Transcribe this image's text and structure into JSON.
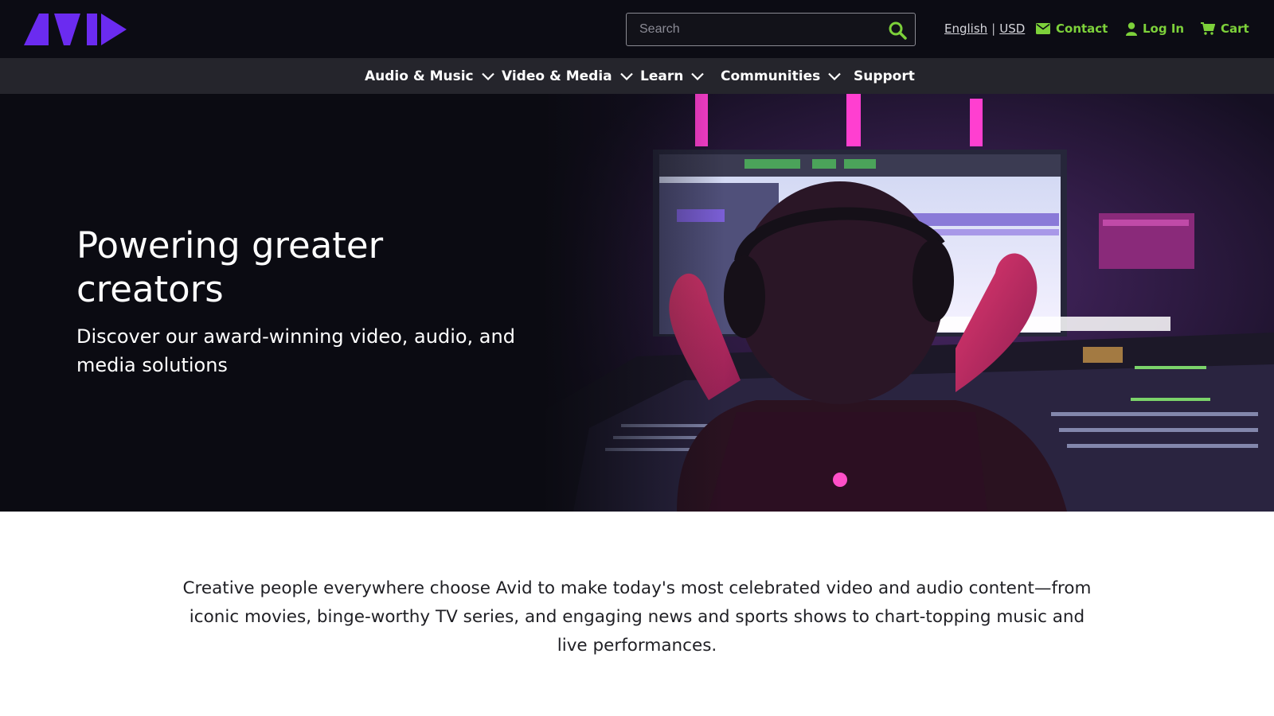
{
  "brand": {
    "name": "AVID",
    "accent_color": "#6b2bf0"
  },
  "header": {
    "search": {
      "placeholder": "Search",
      "value": "",
      "icon": "search-icon"
    },
    "language": "English",
    "currency": "USD",
    "contact_label": "Contact",
    "login_label": "Log In",
    "cart_label": "Cart",
    "link_color": "#7dd13a"
  },
  "nav": {
    "items": [
      {
        "label": "Audio & Music",
        "has_dropdown": true
      },
      {
        "label": "Video & Media",
        "has_dropdown": true
      },
      {
        "label": "Learn",
        "has_dropdown": true
      },
      {
        "label": "Communities",
        "has_dropdown": true
      },
      {
        "label": "Support",
        "has_dropdown": false
      }
    ]
  },
  "hero": {
    "title": "Powering greater creators",
    "subtitle": "Discover our award-winning video, audio, and media solutions"
  },
  "intro": {
    "text": "Creative people everywhere choose Avid to make today's most celebrated video and audio content—from iconic movies, binge-worthy TV series, and engaging news and sports shows to chart-topping music and live performances."
  }
}
